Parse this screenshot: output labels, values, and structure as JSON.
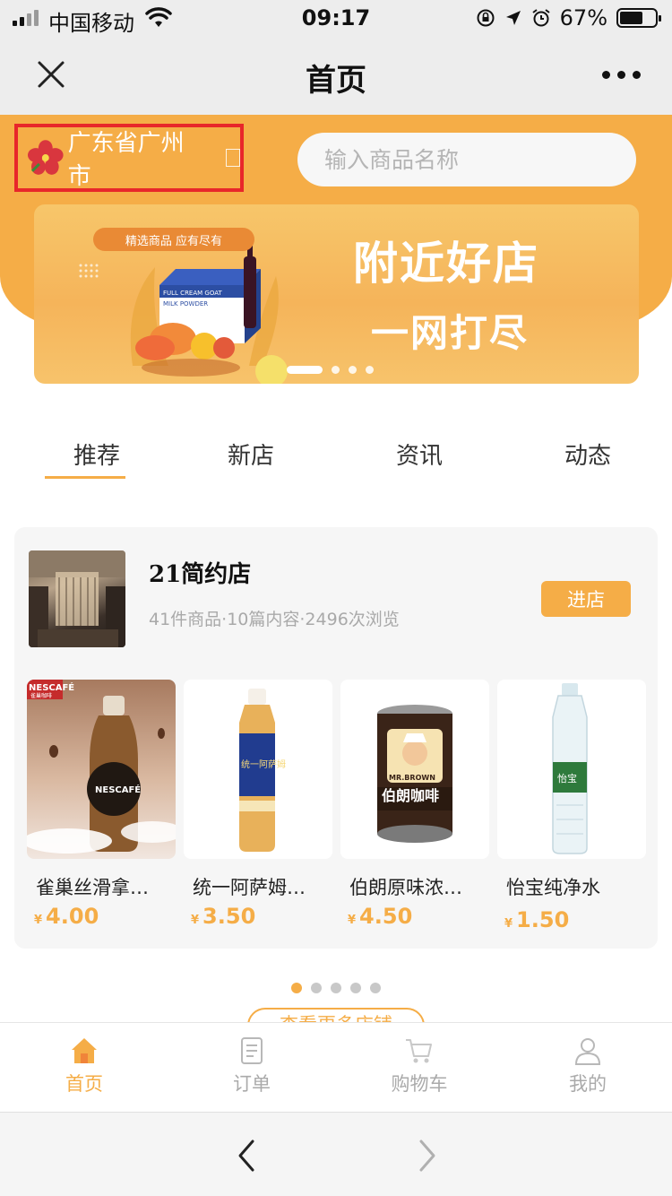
{
  "status_bar": {
    "carrier": "中国移动",
    "time": "09:17",
    "battery": "67%",
    "battery_level": 0.67,
    "icons": [
      "signal-icon",
      "wifi-icon",
      "rotation-lock-icon",
      "location-arrow-icon",
      "alarm-icon",
      "battery-icon"
    ]
  },
  "nav": {
    "title": "首页",
    "close_icon": "close-icon",
    "more_icon": "more-dots-icon"
  },
  "header": {
    "location": "广东省广州市",
    "search_placeholder": "输入商品名称"
  },
  "banner": {
    "ribbon": "精选商品 应有尽有",
    "line1": "附近好店",
    "line2": "一网打尽",
    "box_label_1": "FULL CREAM GOAT",
    "box_label_2": "MILK POWDER",
    "page_count": 4,
    "active_page": 1
  },
  "tabs": [
    {
      "label": "推荐",
      "active": true
    },
    {
      "label": "新店",
      "active": false
    },
    {
      "label": "资讯",
      "active": false
    },
    {
      "label": "动态",
      "active": false
    }
  ],
  "store": {
    "name": "21简约店",
    "meta": "41件商品·10篇内容·2496次浏览",
    "enter_label": "进店",
    "products": [
      {
        "name": "雀巢丝滑拿…",
        "price": "4.00",
        "currency": "¥",
        "brand": "NESCAFÉ",
        "brand_cn": "雀巢咖啡"
      },
      {
        "name": "统一阿萨姆…",
        "price": "3.50",
        "currency": "¥",
        "brand": "统一阿萨姆"
      },
      {
        "name": "伯朗原味浓…",
        "price": "4.50",
        "currency": "¥",
        "brand": "MR.BROWN",
        "brand_cn": "伯朗咖啡"
      },
      {
        "name": "怡宝纯净水",
        "price": "1.50",
        "currency": "¥",
        "brand": "怡宝"
      }
    ]
  },
  "carousel": {
    "page_count": 5,
    "active_page": 1
  },
  "see_more": "查看更多店铺",
  "tabbar": [
    {
      "label": "首页",
      "icon": "home-icon",
      "active": true
    },
    {
      "label": "订单",
      "icon": "order-icon",
      "active": false
    },
    {
      "label": "购物车",
      "icon": "cart-icon",
      "active": false
    },
    {
      "label": "我的",
      "icon": "user-icon",
      "active": false
    }
  ],
  "browser": {
    "back_icon": "back-arrow-icon",
    "forward_icon": "forward-arrow-icon"
  },
  "colors": {
    "accent": "#f5ad47",
    "highlight_border": "#e8262a",
    "nav_bg": "#ededed"
  }
}
